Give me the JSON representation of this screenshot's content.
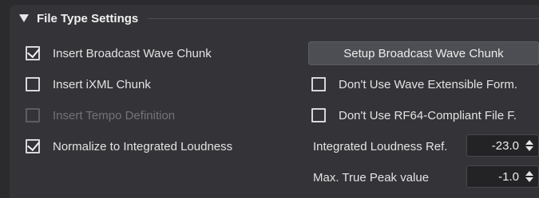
{
  "section": {
    "title": "File Type Settings"
  },
  "left_options": [
    {
      "label": "Insert Broadcast Wave Chunk",
      "checked": true,
      "enabled": true
    },
    {
      "label": "Insert iXML Chunk",
      "checked": false,
      "enabled": true
    },
    {
      "label": "Insert Tempo Definition",
      "checked": false,
      "enabled": false
    },
    {
      "label": "Normalize to Integrated Loudness",
      "checked": true,
      "enabled": true
    }
  ],
  "setup_button": {
    "label": "Setup Broadcast Wave Chunk"
  },
  "right_options": [
    {
      "label": "Don't Use Wave Extensible Form.",
      "checked": false,
      "enabled": true
    },
    {
      "label": "Don't Use RF64-Compliant File F.",
      "checked": false,
      "enabled": true
    }
  ],
  "loudness": {
    "label": "Integrated Loudness Ref.",
    "value": "-23.0"
  },
  "true_peak": {
    "label": "Max. True Peak value",
    "value": "-1.0"
  },
  "icons": {
    "collapse": "triangle-down-icon",
    "check": "checkmark-icon",
    "spin_up": "arrow-up-icon",
    "spin_down": "arrow-down-icon"
  }
}
